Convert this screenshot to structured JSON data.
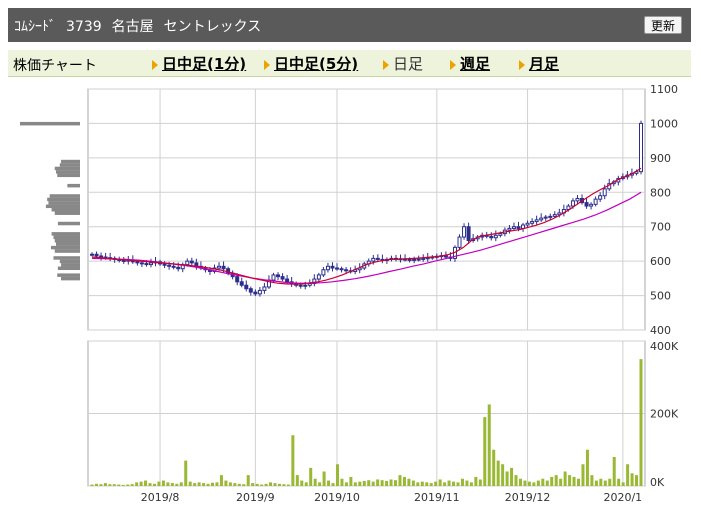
{
  "header": {
    "brand": "ｺﾑｼｰﾄﾞ",
    "code": "3739",
    "market": "名古屋",
    "company": "セントレックス",
    "refresh_label": "更新"
  },
  "tabs": {
    "label": "株価チャート",
    "items": [
      {
        "label": "日中足(1分)",
        "active": false
      },
      {
        "label": "日中足(5分)",
        "active": false
      },
      {
        "label": "日足",
        "active": true
      },
      {
        "label": "週足",
        "active": false
      },
      {
        "label": "月足",
        "active": false
      }
    ]
  },
  "colors": {
    "up_candle": "#ffffff",
    "down_candle": "#2b2f8c",
    "ma_short": "#cc0033",
    "ma_long": "#c000c0",
    "volume": "#99b833",
    "profile": "#888888"
  },
  "chart_data": [
    {
      "type": "candlestick",
      "title": "",
      "x_tick_labels": [
        "2019/8",
        "2019/9",
        "2019/10",
        "2019/11",
        "2019/12",
        "2020/1"
      ],
      "y_tick_labels": [
        "1100",
        "1000",
        "900",
        "800",
        "700",
        "600",
        "500",
        "400"
      ],
      "ylim": [
        400,
        1100
      ],
      "grid": true,
      "series": [
        {
          "name": "",
          "kind": "close",
          "values": [
            620,
            615,
            612,
            610,
            608,
            605,
            602,
            600,
            603,
            598,
            595,
            593,
            590,
            595,
            598,
            592,
            588,
            585,
            582,
            578,
            590,
            600,
            595,
            585,
            580,
            575,
            570,
            580,
            585,
            578,
            565,
            555,
            540,
            530,
            520,
            510,
            505,
            515,
            525,
            545,
            560,
            555,
            548,
            540,
            535,
            530,
            528,
            530,
            535,
            548,
            560,
            575,
            585,
            580,
            578,
            575,
            572,
            570,
            575,
            580,
            592,
            600,
            608,
            605,
            602,
            605,
            608,
            607,
            606,
            605,
            604,
            605,
            606,
            608,
            610,
            612,
            614,
            616,
            612,
            608,
            640,
            670,
            700,
            660,
            665,
            670,
            675,
            672,
            668,
            675,
            680,
            690,
            695,
            700,
            695,
            705,
            710,
            715,
            720,
            725,
            728,
            730,
            735,
            740,
            750,
            760,
            775,
            782,
            770,
            760,
            765,
            780,
            790,
            810,
            825,
            830,
            840,
            845,
            850,
            855,
            860,
            1000
          ]
        }
      ]
    },
    {
      "type": "line",
      "title": "",
      "series": [
        {
          "name": "",
          "kind": "ma_short",
          "values": [
            612,
            610,
            608,
            606,
            604,
            602,
            600,
            598,
            596,
            594,
            592,
            590,
            588,
            585,
            582,
            578,
            574,
            568,
            562,
            556,
            550,
            545,
            540,
            536,
            534,
            533,
            534,
            537,
            540,
            545,
            552,
            560,
            570,
            580,
            590,
            597,
            602,
            605,
            606,
            607,
            608,
            610,
            612,
            614,
            618,
            626,
            640,
            660,
            672,
            676,
            680,
            684,
            688,
            692,
            698,
            704,
            712,
            722,
            734,
            748,
            764,
            780,
            795,
            808,
            820,
            835,
            845,
            855,
            870
          ]
        },
        {
          "name": "",
          "kind": "ma_long",
          "values": [
            608,
            607,
            606,
            605,
            603,
            600,
            596,
            592,
            588,
            583,
            577,
            570,
            563,
            557,
            551,
            546,
            542,
            538,
            536,
            536,
            537,
            540,
            544,
            549,
            555,
            562,
            570,
            577,
            585,
            592,
            600,
            608,
            616,
            624,
            632,
            642,
            652,
            662,
            672,
            682,
            692,
            702,
            712,
            722,
            734,
            748,
            764,
            780,
            800
          ]
        }
      ]
    },
    {
      "type": "bar",
      "title": "",
      "y_tick_labels": [
        "400K",
        "200K",
        "0K"
      ],
      "ylim": [
        0,
        400000
      ],
      "x_tick_labels": [
        "2019/8",
        "2019/9",
        "2019/10",
        "2019/11",
        "2019/12",
        "2020/1"
      ],
      "series": [
        {
          "name": "",
          "values": [
            4000,
            6000,
            5000,
            8000,
            5000,
            5000,
            4000,
            3000,
            4000,
            5000,
            10000,
            12000,
            15000,
            8000,
            6000,
            12000,
            15000,
            10000,
            8000,
            6000,
            10000,
            70000,
            12000,
            8000,
            10000,
            8000,
            6000,
            9000,
            10000,
            30000,
            15000,
            10000,
            8000,
            6000,
            5000,
            30000,
            8000,
            6000,
            4000,
            6000,
            10000,
            8000,
            6000,
            5000,
            4000,
            140000,
            30000,
            15000,
            10000,
            50000,
            20000,
            10000,
            40000,
            15000,
            8000,
            60000,
            20000,
            10000,
            25000,
            10000,
            12000,
            14000,
            16000,
            12000,
            18000,
            16000,
            14000,
            18000,
            16000,
            30000,
            25000,
            20000,
            15000,
            10000,
            12000,
            10000,
            8000,
            12000,
            18000,
            10000,
            15000,
            12000,
            10000,
            20000,
            15000,
            10000,
            25000,
            18000,
            190000,
            225000,
            100000,
            70000,
            60000,
            40000,
            50000,
            30000,
            20000,
            15000,
            12000,
            10000,
            15000,
            20000,
            15000,
            25000,
            30000,
            20000,
            40000,
            30000,
            25000,
            20000,
            60000,
            100000,
            30000,
            15000,
            20000,
            15000,
            20000,
            80000,
            20000,
            10000,
            60000,
            35000,
            30000,
            350000
          ]
        }
      ]
    },
    {
      "type": "bar",
      "title": "",
      "orientation": "horizontal",
      "values": [
        95,
        0,
        0,
        0,
        0,
        0,
        0,
        0,
        0,
        0,
        0,
        30,
        32,
        40,
        38,
        36,
        0,
        0,
        20,
        0,
        0,
        48,
        52,
        50,
        54,
        45,
        40,
        0,
        0,
        35,
        0,
        0,
        45,
        42,
        40,
        38,
        46,
        40,
        0,
        42,
        32,
        30,
        35,
        0,
        36,
        30,
        0,
        0,
        0,
        0
      ]
    }
  ]
}
